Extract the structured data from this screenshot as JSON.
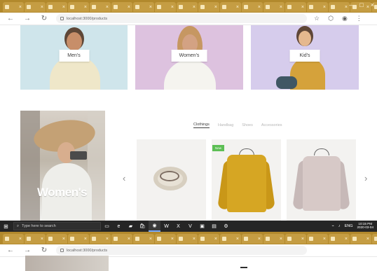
{
  "browser_top": {
    "tabs_count": 34,
    "active_tab_index": 29,
    "new_tab_symbol": "+",
    "window_controls": [
      "–",
      "□",
      "×"
    ],
    "address": "localhost:3000/products",
    "toolbar_icons": [
      "back-icon",
      "forward-icon",
      "refresh-icon",
      "lock-icon",
      "star-icon",
      "extensions-icon",
      "profile-icon",
      "menu-icon"
    ]
  },
  "categories": [
    {
      "label": "Men's",
      "color": "#cfe5eb"
    },
    {
      "label": "Women's",
      "color": "#ddc2df"
    },
    {
      "label": "Kid's",
      "color": "#d6ccec"
    }
  ],
  "promo": {
    "title": "Women's",
    "caption": ""
  },
  "product_tabs": [
    "Clothings",
    "Handbag",
    "Shoes",
    "Accessories"
  ],
  "products": [
    {
      "name": "Beige bag",
      "badge": ""
    },
    {
      "name": "Yellow sweater",
      "badge": "New"
    },
    {
      "name": "Pink sweater",
      "badge": ""
    }
  ],
  "taskbar": {
    "search_placeholder": "Type here to search",
    "tray_time": "10:15 PM",
    "tray_date": "2020-03-04",
    "language": "ENG",
    "icons": [
      "windows-icon",
      "search-icon",
      "task-view-icon",
      "edge-icon",
      "explorer-icon",
      "store-icon",
      "chrome-icon",
      "word-icon",
      "excel-icon",
      "vs-icon",
      "terminal-icon",
      "photos-icon",
      "settings-icon"
    ]
  },
  "browser_bottom": {
    "address": "localhost:3000/products"
  }
}
